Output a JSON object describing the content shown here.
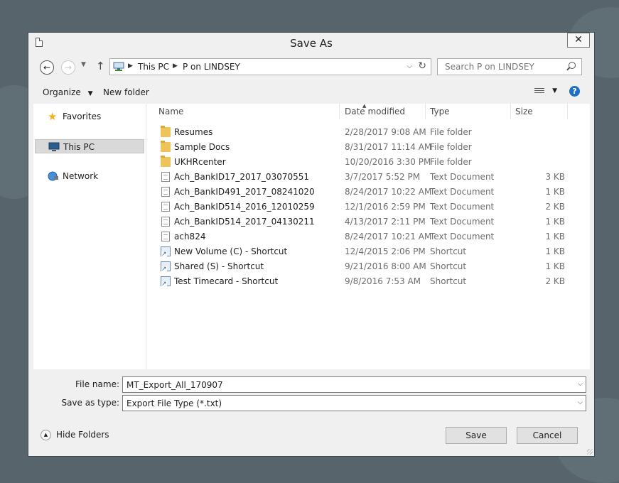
{
  "dialog": {
    "title": "Save As",
    "close_label": "✕"
  },
  "nav": {
    "back_icon": "back-arrow-icon",
    "forward_icon": "forward-arrow-icon",
    "address": {
      "crumbs": [
        "This PC",
        "P on LINDSEY"
      ]
    },
    "search_placeholder": "Search P on LINDSEY"
  },
  "toolbar": {
    "organize_label": "Organize",
    "new_folder_label": "New folder",
    "help_label": "?"
  },
  "sidebar": {
    "items": [
      {
        "label": "Favorites",
        "icon": "star-icon",
        "selected": false
      },
      {
        "label": "This PC",
        "icon": "computer-icon",
        "selected": true
      },
      {
        "label": "Network",
        "icon": "network-icon",
        "selected": false
      }
    ]
  },
  "columns": {
    "name": "Name",
    "date": "Date modified",
    "type": "Type",
    "size": "Size"
  },
  "files": [
    {
      "name": "Resumes",
      "date": "2/28/2017 9:08 AM",
      "type": "File folder",
      "size": "",
      "icon": "folder"
    },
    {
      "name": "Sample Docs",
      "date": "8/31/2017 11:14 AM",
      "type": "File folder",
      "size": "",
      "icon": "folder"
    },
    {
      "name": "UKHRcenter",
      "date": "10/20/2016 3:30 PM",
      "type": "File folder",
      "size": "",
      "icon": "folder"
    },
    {
      "name": "Ach_BankID17_2017_03070551",
      "date": "3/7/2017 5:52 PM",
      "type": "Text Document",
      "size": "3 KB",
      "icon": "txt"
    },
    {
      "name": "Ach_BankID491_2017_08241020",
      "date": "8/24/2017 10:22 AM",
      "type": "Text Document",
      "size": "1 KB",
      "icon": "txt"
    },
    {
      "name": "Ach_BankID514_2016_12010259",
      "date": "12/1/2016 2:59 PM",
      "type": "Text Document",
      "size": "2 KB",
      "icon": "txt"
    },
    {
      "name": "Ach_BankID514_2017_04130211",
      "date": "4/13/2017 2:11 PM",
      "type": "Text Document",
      "size": "1 KB",
      "icon": "txt"
    },
    {
      "name": "ach824",
      "date": "8/24/2017 10:21 AM",
      "type": "Text Document",
      "size": "1 KB",
      "icon": "txt"
    },
    {
      "name": "New Volume (C) - Shortcut",
      "date": "12/4/2015 2:06 PM",
      "type": "Shortcut",
      "size": "1 KB",
      "icon": "shortcut"
    },
    {
      "name": "Shared (S) - Shortcut",
      "date": "9/21/2016 8:00 AM",
      "type": "Shortcut",
      "size": "1 KB",
      "icon": "shortcut"
    },
    {
      "name": "Test Timecard - Shortcut",
      "date": "9/8/2016 7:53 AM",
      "type": "Shortcut",
      "size": "2 KB",
      "icon": "shortcut"
    }
  ],
  "form": {
    "file_name_label": "File name:",
    "file_name_value": "MT_Export_All_170907",
    "save_type_label": "Save as type:",
    "save_type_value": "Export File Type (*.txt)"
  },
  "footer": {
    "hide_folders_label": "Hide Folders",
    "save_label": "Save",
    "cancel_label": "Cancel"
  }
}
